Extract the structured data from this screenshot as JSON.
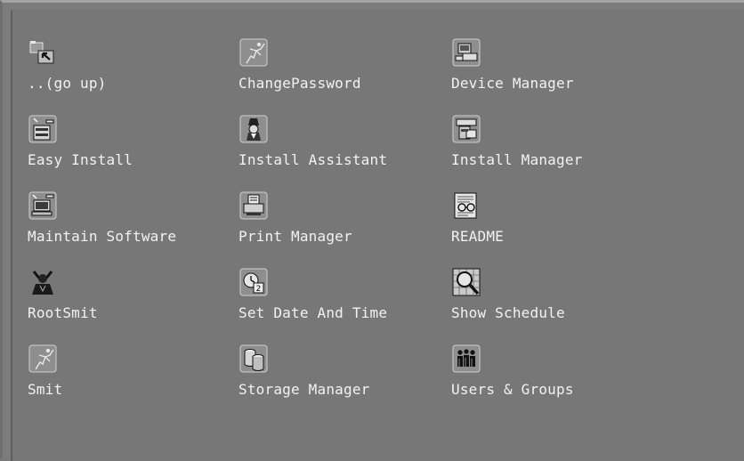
{
  "items": [
    {
      "label": "..(go up)",
      "icon": "go-up-folder-icon"
    },
    {
      "label": "ChangePassword",
      "icon": "running-man-icon"
    },
    {
      "label": "Device Manager",
      "icon": "device-manager-icon"
    },
    {
      "label": "Easy Install",
      "icon": "easy-install-icon"
    },
    {
      "label": "Install Assistant",
      "icon": "wizard-icon"
    },
    {
      "label": "Install Manager",
      "icon": "install-manager-icon"
    },
    {
      "label": "Maintain Software",
      "icon": "maintain-software-icon"
    },
    {
      "label": "Print Manager",
      "icon": "printer-icon"
    },
    {
      "label": "README",
      "icon": "readme-glasses-icon"
    },
    {
      "label": "RootSmit",
      "icon": "root-person-icon"
    },
    {
      "label": "Set Date And Time",
      "icon": "clock-calendar-icon"
    },
    {
      "label": "Show Schedule",
      "icon": "magnifier-schedule-icon"
    },
    {
      "label": "Smit",
      "icon": "running-man-icon"
    },
    {
      "label": "Storage Manager",
      "icon": "storage-drums-icon"
    },
    {
      "label": "Users & Groups",
      "icon": "users-groups-icon"
    }
  ]
}
